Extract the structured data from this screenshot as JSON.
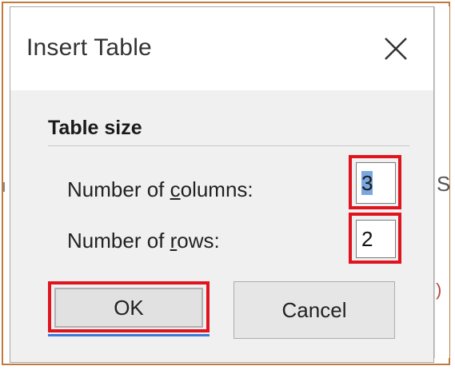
{
  "dialog": {
    "title": "Insert Table",
    "close_icon": "close-icon"
  },
  "table_size": {
    "group_label": "Table size",
    "columns": {
      "label_prefix": "Number of ",
      "label_mnemonic": "c",
      "label_suffix": "olumns:",
      "value": "3"
    },
    "rows": {
      "label_prefix": "Number of ",
      "label_mnemonic": "r",
      "label_suffix": "ows:",
      "value": "2"
    }
  },
  "buttons": {
    "ok_label": "OK",
    "cancel_label": "Cancel"
  },
  "colors": {
    "highlight": "#e0141e",
    "frame": "#c07a3f",
    "selection": "#7aa7e0",
    "focus_underline": "#3c78d8"
  }
}
